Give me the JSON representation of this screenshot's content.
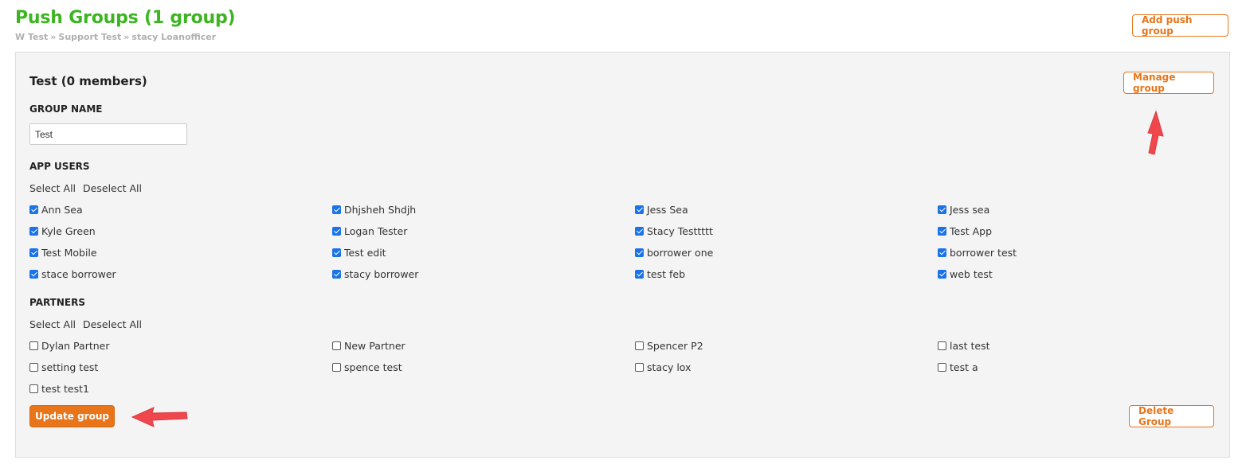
{
  "header": {
    "title": "Push Groups (1 group)",
    "breadcrumb": [
      "W Test",
      "Support Test",
      "stacy Loanofficer"
    ],
    "breadcrumb_sep": "»",
    "add_button": "Add push group"
  },
  "group": {
    "title": "Test (0 members)",
    "manage_button": "Manage group",
    "name_label": "GROUP NAME",
    "name_value": "Test",
    "app_users": {
      "label": "APP USERS",
      "select_all": "Select All",
      "deselect_all": "Deselect All",
      "rows": [
        [
          {
            "label": "Ann Sea",
            "checked": true
          },
          {
            "label": "Dhjsheh Shdjh",
            "checked": true
          },
          {
            "label": "Jess Sea",
            "checked": true
          },
          {
            "label": "Jess sea",
            "checked": true
          }
        ],
        [
          {
            "label": "Kyle Green",
            "checked": true
          },
          {
            "label": "Logan Tester",
            "checked": true
          },
          {
            "label": "Stacy Testtttt",
            "checked": true
          },
          {
            "label": "Test App",
            "checked": true
          }
        ],
        [
          {
            "label": "Test Mobile",
            "checked": true
          },
          {
            "label": "Test edit",
            "checked": true
          },
          {
            "label": "borrower one",
            "checked": true
          },
          {
            "label": "borrower test",
            "checked": true
          }
        ],
        [
          {
            "label": "stace borrower",
            "checked": true
          },
          {
            "label": "stacy borrower",
            "checked": true
          },
          {
            "label": "test feb",
            "checked": true
          },
          {
            "label": "web test",
            "checked": true
          }
        ]
      ]
    },
    "partners": {
      "label": "PARTNERS",
      "select_all": "Select All",
      "deselect_all": "Deselect All",
      "rows": [
        [
          {
            "label": "Dylan Partner",
            "checked": false
          },
          {
            "label": "New Partner",
            "checked": false
          },
          {
            "label": "Spencer P2",
            "checked": false
          },
          {
            "label": "last test",
            "checked": false
          }
        ],
        [
          {
            "label": "setting test",
            "checked": false
          },
          {
            "label": "spence test",
            "checked": false
          },
          {
            "label": "stacy lox",
            "checked": false
          },
          {
            "label": "test a",
            "checked": false
          }
        ],
        [
          {
            "label": "test test1",
            "checked": false
          }
        ]
      ]
    },
    "update_button": "Update group",
    "delete_button": "Delete Group"
  },
  "colors": {
    "title_green": "#3cb521",
    "accent_orange": "#e8751a",
    "checkbox_blue": "#1a73e8",
    "annotation_red": "#f0474d"
  }
}
